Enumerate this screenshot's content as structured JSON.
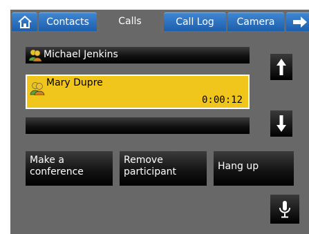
{
  "tabs": {
    "home_icon": "house-icon",
    "contacts": "Contacts",
    "calls": "Calls",
    "call_log": "Call Log",
    "camera": "Camera",
    "next_icon": "arrow-right-icon"
  },
  "calls": [
    {
      "name": "Michael Jenkins",
      "duration": "",
      "active": false
    },
    {
      "name": "Mary Dupre",
      "duration": "0:00:12",
      "active": true
    },
    {
      "name": "",
      "duration": "",
      "active": false
    }
  ],
  "buttons": {
    "conference": "Make a\nconference",
    "remove": "Remove\nparticipant",
    "hangup": "Hang up"
  },
  "colors": {
    "active_call": "#f0c51c",
    "tab_blue": "#2f74c4",
    "background": "#686868"
  }
}
